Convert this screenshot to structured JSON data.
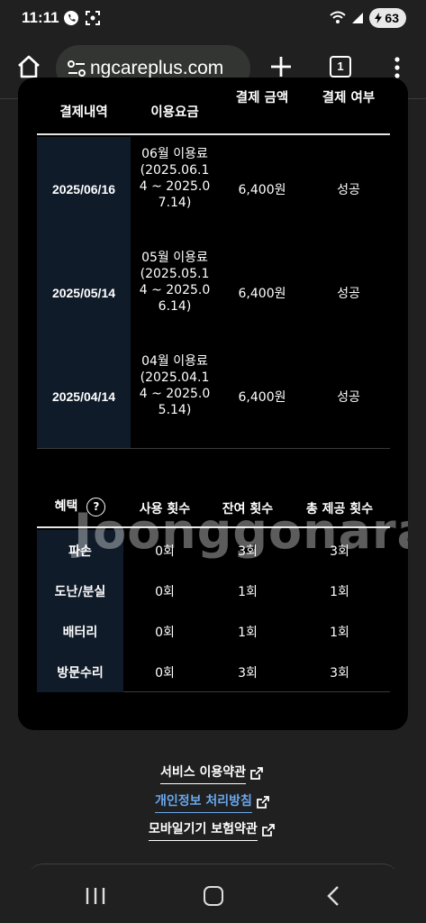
{
  "status_bar": {
    "time": "11:11",
    "battery": "63",
    "icons": [
      "phone-icon",
      "screen-capture-icon",
      "wifi-icon",
      "signal-icon",
      "battery-icon"
    ]
  },
  "browser": {
    "url": "ngcareplus.com",
    "tab_count": "1",
    "icons": [
      "home-icon",
      "site-settings-icon",
      "new-tab-plus-icon",
      "tabs-icon",
      "more-menu-icon"
    ]
  },
  "payment_table": {
    "headers": [
      "결제내역",
      "이용요금",
      "결제 금액",
      "결제 여부"
    ],
    "rows": [
      {
        "date": "2025/06/16",
        "desc": "06월 이용료\n(2025.06.1\n4 ~ 2025.0\n7.14)",
        "amount": "6,400원",
        "result": "성공"
      },
      {
        "date": "2025/05/14",
        "desc": "05월 이용료\n(2025.05.1\n4 ~ 2025.0\n6.14)",
        "amount": "6,400원",
        "result": "성공"
      },
      {
        "date": "2025/04/14",
        "desc": "04월 이용료\n(2025.04.1\n4 ~ 2025.0\n5.14)",
        "amount": "6,400원",
        "result": "성공"
      }
    ]
  },
  "watermark": "Joonggonara",
  "benefit_table": {
    "headers": {
      "benefit": "혜택",
      "help": "?",
      "used": "사용 횟수",
      "remaining": "잔여 횟수",
      "total": "총 제공 횟수"
    },
    "rows": [
      {
        "name": "파손",
        "used": "0회",
        "remaining": "3회",
        "total": "3회"
      },
      {
        "name": "도난/분실",
        "used": "0회",
        "remaining": "1회",
        "total": "1회"
      },
      {
        "name": "배터리",
        "used": "0회",
        "remaining": "1회",
        "total": "1회"
      },
      {
        "name": "방문수리",
        "used": "0회",
        "remaining": "3회",
        "total": "3회"
      }
    ]
  },
  "footer": {
    "terms": "서비스 이용약관",
    "privacy": "개인정보 처리방침",
    "insurance": "모바일기기 보험약관",
    "colors": {
      "privacy_link": "#6aa7ee"
    }
  },
  "colors": {
    "page_bg": "#1f201f",
    "card_bg": "#000000",
    "date_col_bg": "#0f1b29"
  }
}
